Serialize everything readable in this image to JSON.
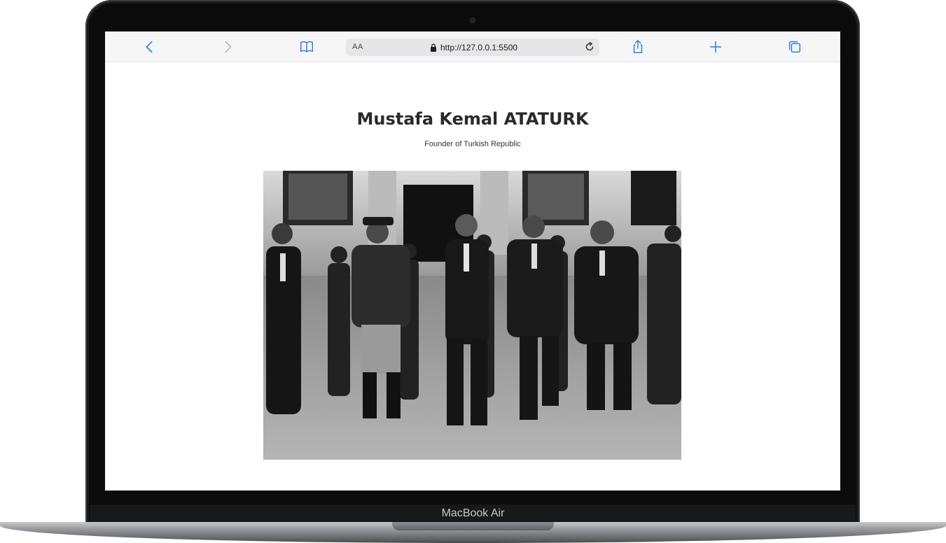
{
  "device": {
    "model_label": "MacBook Air"
  },
  "browser": {
    "text_size_label": "AA",
    "url": "http://127.0.0.1:5500",
    "icons": {
      "back": "chevron-left-icon",
      "forward": "chevron-right-icon",
      "bookmarks": "book-icon",
      "lock": "lock-icon",
      "reload": "reload-icon",
      "share": "share-icon",
      "new_tab": "plus-icon",
      "tabs": "tabs-icon"
    },
    "accent_color": "#2b7de9"
  },
  "page": {
    "title": "Mustafa Kemal ATATURK",
    "subtitle": "Founder of Turkish Republic"
  }
}
